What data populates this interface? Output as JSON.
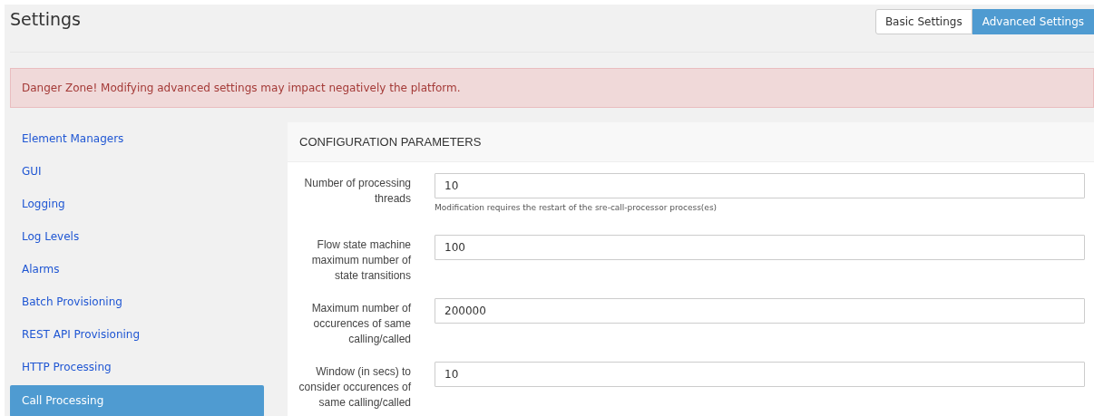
{
  "header": {
    "title": "Settings"
  },
  "tabs": [
    {
      "label": "Basic Settings",
      "selected": false
    },
    {
      "label": "Advanced Settings",
      "selected": true
    }
  ],
  "alert": {
    "text": "Danger Zone! Modifying advanced settings may impact negatively the platform."
  },
  "sidebar": {
    "items": [
      {
        "label": "Element Managers",
        "selected": false
      },
      {
        "label": "GUI",
        "selected": false
      },
      {
        "label": "Logging",
        "selected": false
      },
      {
        "label": "Log Levels",
        "selected": false
      },
      {
        "label": "Alarms",
        "selected": false
      },
      {
        "label": "Batch Provisioning",
        "selected": false
      },
      {
        "label": "REST API Provisioning",
        "selected": false
      },
      {
        "label": "HTTP Processing",
        "selected": false
      },
      {
        "label": "Call Processing",
        "selected": true
      }
    ]
  },
  "panel": {
    "title": "CONFIGURATION PARAMETERS",
    "fields": [
      {
        "label": "Number of processing threads",
        "value": "10",
        "help": "Modification requires the restart of the sre-call-processor process(es)"
      },
      {
        "label": "Flow state machine maximum number of state transitions",
        "value": "100"
      },
      {
        "label": "Maximum number of occurences of same calling/called",
        "value": "200000"
      },
      {
        "label": "Window (in secs) to consider occurences of same calling/called",
        "value": "10"
      }
    ]
  }
}
